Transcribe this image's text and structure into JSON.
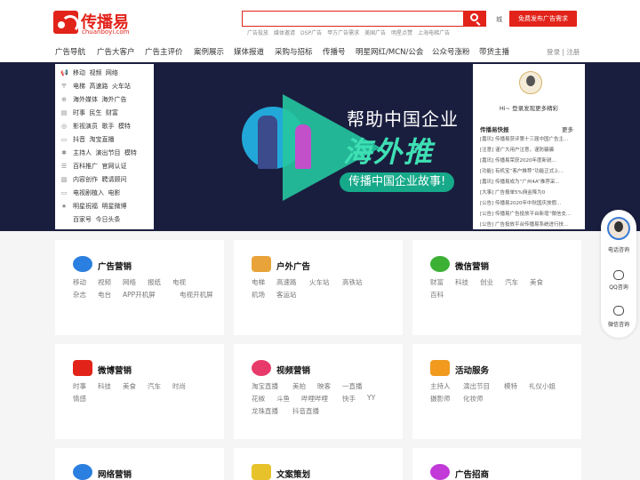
{
  "brand": {
    "name": "传播易",
    "domain": "chuanboyi.com"
  },
  "search": {
    "placeholder": "",
    "hotkeys": [
      "广告投放",
      "媒体邀请",
      "DSP广告",
      "甲方广告需求",
      "美国广告",
      "明星点赞",
      "上海电梯广告"
    ]
  },
  "header": {
    "city": "城",
    "publish_button": "免费发布广告需求"
  },
  "nav": [
    "广告导航",
    "广告大客户",
    "广告主评价",
    "案例展示",
    "媒体报道",
    "采购与招标",
    "传播号",
    "明星网红/MCN/公会",
    "公众号涨粉",
    "带货主播"
  ],
  "login": {
    "login": "登录",
    "sep": "|",
    "register": "注册"
  },
  "menu": [
    {
      "icon": "📢",
      "items": [
        "移动",
        "视频",
        "网络"
      ]
    },
    {
      "icon": "〒",
      "items": [
        "电梯",
        "高速路",
        "火车站"
      ]
    },
    {
      "icon": "⊕",
      "items": [
        "海外媒体",
        "海外广告"
      ]
    },
    {
      "icon": "▤",
      "items": [
        "时事",
        "民生",
        "财富"
      ]
    },
    {
      "icon": "◎",
      "items": [
        "影视演员",
        "歌手",
        "模特"
      ]
    },
    {
      "icon": "▭",
      "items": [
        "抖音",
        "淘宝直播"
      ]
    },
    {
      "icon": "✱",
      "items": [
        "主持人",
        "演出节目",
        "模特"
      ]
    },
    {
      "icon": "☰",
      "items": [
        "百科推广",
        "官网认证"
      ]
    },
    {
      "icon": "▧",
      "items": [
        "内容创作",
        "聘请顾问"
      ]
    },
    {
      "icon": "▭",
      "items": [
        "电视剧植入",
        "电影"
      ]
    },
    {
      "icon": "★",
      "items": [
        "明星祝福",
        "明星微博"
      ]
    },
    {
      "icon": "",
      "items": [
        "百家号",
        "今日头条"
      ]
    }
  ],
  "banner": {
    "line1": "帮助中国企业",
    "line2": "海外推",
    "line3": "传播中国企业故事!"
  },
  "news": {
    "greeting": "Hi~ 登录发现更多精彩",
    "title": "传播易快报",
    "more": "更多",
    "items": [
      "[嘉讯] 传播易获评第十三届中国广告主...",
      "[注意] 谨广大用户注意，谨防骗骗",
      "[嘉讯] 传播易荣获2020年度新锐...",
      "[功能] 有机宝“客户推荐”功能正式上...",
      "[嘉讯] 传播易成为“广州4A”推荐采...",
      "[大事] 广告报单5%佣金降为0",
      "[公告] 传播易2020年中秋国庆放假...",
      "[公告] 传播易广告投放平台新增“微信支...",
      "[公告] 广告投放平台传播易系统进行技..."
    ]
  },
  "side": {
    "phone": "电话咨询",
    "qq": "QQ咨询",
    "wechat": "微信咨询"
  },
  "cards": [
    {
      "title": "广告营销",
      "color": "#2b7fe0",
      "tags": [
        [
          "移动",
          "视频",
          "网络",
          "报纸",
          "电视"
        ],
        [
          "杂志",
          "电台",
          "APP开机屏",
          "电视开机屏"
        ]
      ]
    },
    {
      "title": "户外广告",
      "color": "#e8a33a",
      "tags": [
        [
          "电梯",
          "高速路",
          "火车站",
          "高铁站"
        ],
        [
          "机场",
          "客运站"
        ]
      ]
    },
    {
      "title": "微信营销",
      "color": "#3cb034",
      "tags": [
        [
          "财富",
          "科技",
          "创业",
          "汽车",
          "美食"
        ],
        [
          "百科"
        ]
      ]
    },
    {
      "title": "微博营销",
      "color": "#e2231a",
      "tags": [
        [
          "时事",
          "科技",
          "美食",
          "汽车",
          "时尚"
        ],
        [
          "情感"
        ]
      ]
    },
    {
      "title": "视频营销",
      "color": "#e83a6a",
      "tags": [
        [
          "淘宝直播",
          "美拍",
          "映客",
          "一直播"
        ],
        [
          "花椒",
          "斗鱼",
          "哔哩哔哩",
          "快手",
          "YY"
        ],
        [
          "龙珠直播",
          "抖音直播"
        ]
      ]
    },
    {
      "title": "活动服务",
      "color": "#f29a1e",
      "tags": [
        [
          "主持人",
          "演出节目",
          "模特",
          "礼仪小姐"
        ],
        [
          "摄影师",
          "化妆师"
        ]
      ]
    },
    {
      "title": "网络营销",
      "color": "#2b7fe0",
      "tags": []
    },
    {
      "title": "文案策划",
      "color": "#e8c22a",
      "tags": []
    },
    {
      "title": "广告招商",
      "color": "#c23ad8",
      "tags": []
    }
  ]
}
